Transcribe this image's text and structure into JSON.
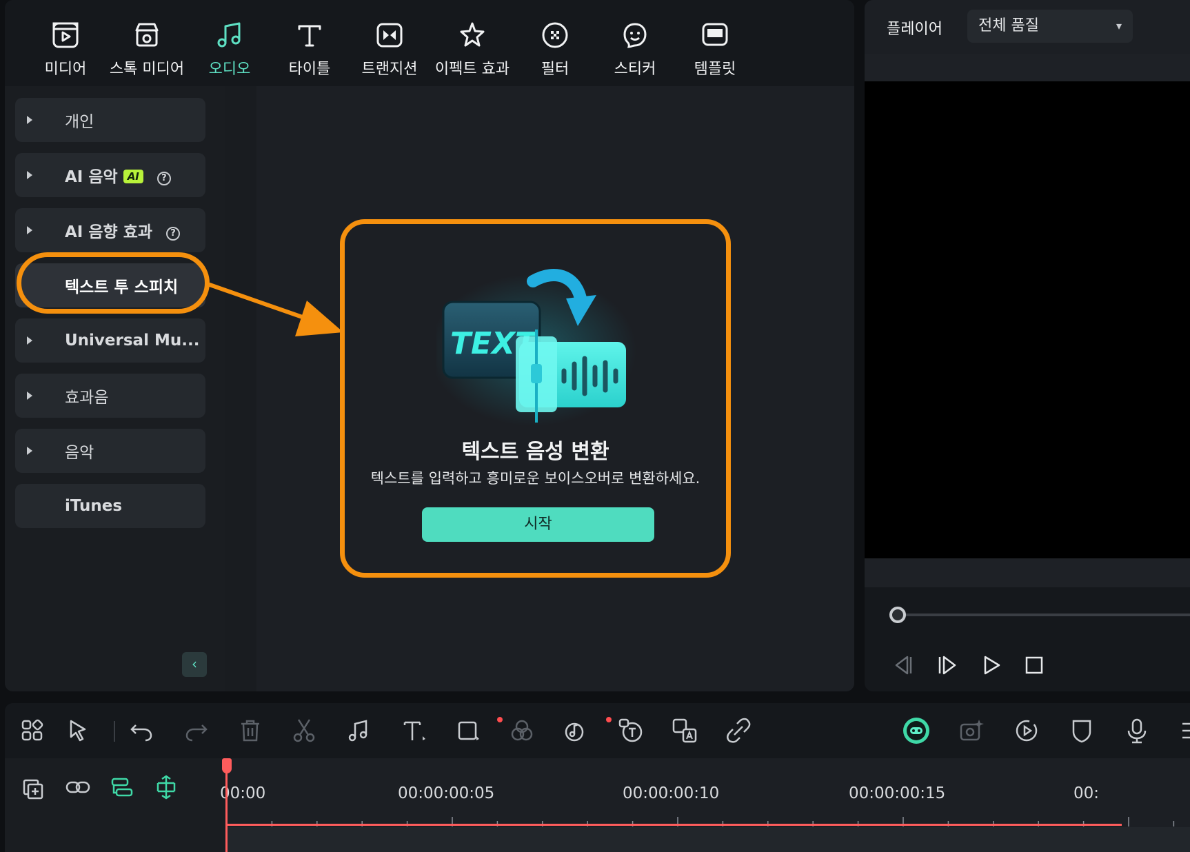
{
  "top_tabs": [
    {
      "label": "미디어",
      "icon": "media-icon"
    },
    {
      "label": "스톡 미디어",
      "icon": "stock-media-icon"
    },
    {
      "label": "오디오",
      "icon": "music-note-icon",
      "active": true
    },
    {
      "label": "타이틀",
      "icon": "title-t-icon"
    },
    {
      "label": "트랜지션",
      "icon": "transition-icon"
    },
    {
      "label": "이펙트 효과",
      "icon": "effects-star-icon"
    },
    {
      "label": "필터",
      "icon": "filter-icon"
    },
    {
      "label": "스티커",
      "icon": "sticker-icon"
    },
    {
      "label": "템플릿",
      "icon": "template-icon"
    }
  ],
  "sidebar": {
    "items": [
      {
        "label": "개인"
      },
      {
        "label": "AI 음악",
        "badge": "AI"
      },
      {
        "label": "AI 음향 효과"
      },
      {
        "label": "텍스트 투 스피치"
      },
      {
        "label": "Universal Mu..."
      },
      {
        "label": "효과음"
      },
      {
        "label": "음악"
      },
      {
        "label": "iTunes"
      }
    ],
    "help_glyph": "?",
    "collapse_glyph": "‹"
  },
  "tts_card": {
    "art_text": "TEXT",
    "title": "텍스트 음성 변환",
    "description": "텍스트를 입력하고 흥미로운 보이스오버로 변환하세요.",
    "start_label": "시작"
  },
  "player": {
    "title": "플레이어",
    "quality": "전체 품질"
  },
  "timeline": {
    "times": [
      "00:00",
      "00:00:00:05",
      "00:00:00:10",
      "00:00:00:15",
      "00:"
    ]
  },
  "colors": {
    "accent": "#5ee0c3",
    "highlight": "#f5900e",
    "playhead": "#ff5c5c",
    "ai_badge": "#b8f23a"
  }
}
